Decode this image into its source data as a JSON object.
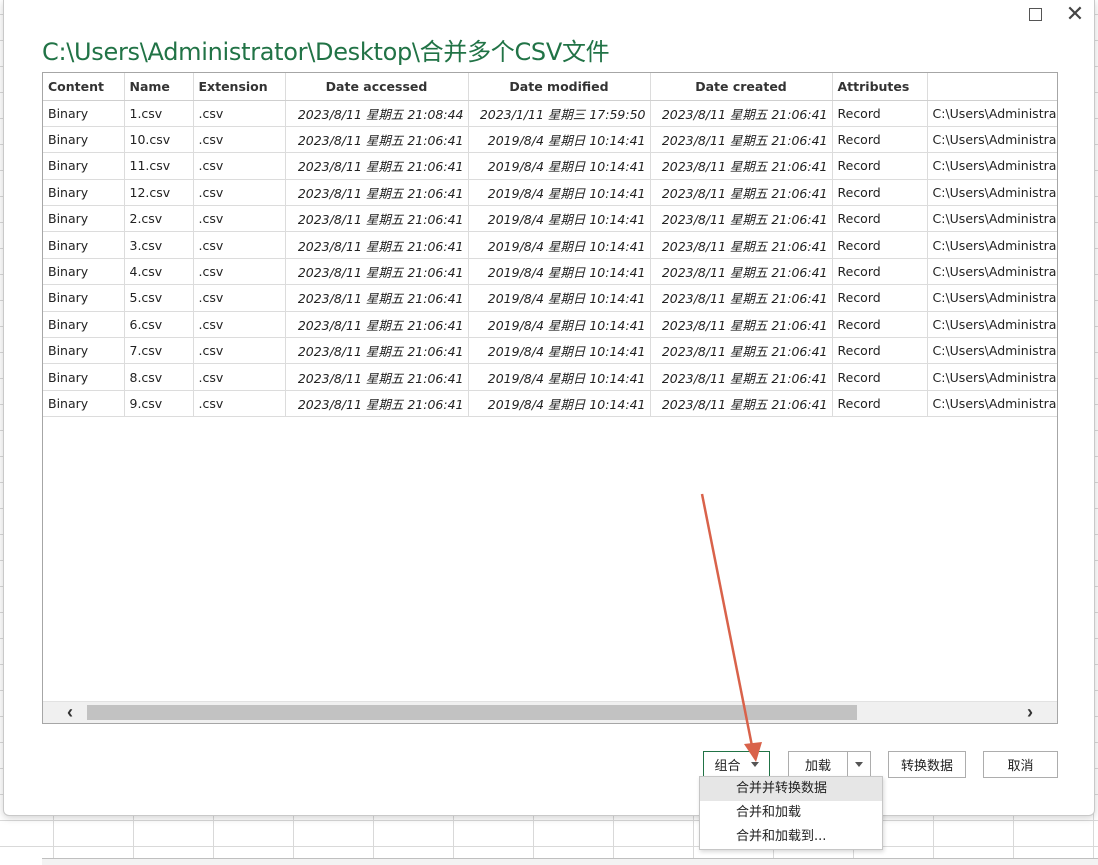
{
  "dialog": {
    "path_title": "C:\\Users\\Administrator\\Desktop\\合并多个CSV文件"
  },
  "table": {
    "columns": [
      "Content",
      "Name",
      "Extension",
      "Date accessed",
      "Date modified",
      "Date created",
      "Attributes",
      "F"
    ],
    "rows": [
      [
        "Binary",
        "1.csv",
        ".csv",
        "2023/8/11 星期五 21:08:44",
        "2023/1/11 星期三 17:59:50",
        "2023/8/11 星期五 21:06:41",
        "Record",
        "C:\\Users\\Administra"
      ],
      [
        "Binary",
        "10.csv",
        ".csv",
        "2023/8/11 星期五 21:06:41",
        "2019/8/4 星期日 10:14:41",
        "2023/8/11 星期五 21:06:41",
        "Record",
        "C:\\Users\\Administra"
      ],
      [
        "Binary",
        "11.csv",
        ".csv",
        "2023/8/11 星期五 21:06:41",
        "2019/8/4 星期日 10:14:41",
        "2023/8/11 星期五 21:06:41",
        "Record",
        "C:\\Users\\Administra"
      ],
      [
        "Binary",
        "12.csv",
        ".csv",
        "2023/8/11 星期五 21:06:41",
        "2019/8/4 星期日 10:14:41",
        "2023/8/11 星期五 21:06:41",
        "Record",
        "C:\\Users\\Administra"
      ],
      [
        "Binary",
        "2.csv",
        ".csv",
        "2023/8/11 星期五 21:06:41",
        "2019/8/4 星期日 10:14:41",
        "2023/8/11 星期五 21:06:41",
        "Record",
        "C:\\Users\\Administra"
      ],
      [
        "Binary",
        "3.csv",
        ".csv",
        "2023/8/11 星期五 21:06:41",
        "2019/8/4 星期日 10:14:41",
        "2023/8/11 星期五 21:06:41",
        "Record",
        "C:\\Users\\Administra"
      ],
      [
        "Binary",
        "4.csv",
        ".csv",
        "2023/8/11 星期五 21:06:41",
        "2019/8/4 星期日 10:14:41",
        "2023/8/11 星期五 21:06:41",
        "Record",
        "C:\\Users\\Administra"
      ],
      [
        "Binary",
        "5.csv",
        ".csv",
        "2023/8/11 星期五 21:06:41",
        "2019/8/4 星期日 10:14:41",
        "2023/8/11 星期五 21:06:41",
        "Record",
        "C:\\Users\\Administra"
      ],
      [
        "Binary",
        "6.csv",
        ".csv",
        "2023/8/11 星期五 21:06:41",
        "2019/8/4 星期日 10:14:41",
        "2023/8/11 星期五 21:06:41",
        "Record",
        "C:\\Users\\Administra"
      ],
      [
        "Binary",
        "7.csv",
        ".csv",
        "2023/8/11 星期五 21:06:41",
        "2019/8/4 星期日 10:14:41",
        "2023/8/11 星期五 21:06:41",
        "Record",
        "C:\\Users\\Administra"
      ],
      [
        "Binary",
        "8.csv",
        ".csv",
        "2023/8/11 星期五 21:06:41",
        "2019/8/4 星期日 10:14:41",
        "2023/8/11 星期五 21:06:41",
        "Record",
        "C:\\Users\\Administra"
      ],
      [
        "Binary",
        "9.csv",
        ".csv",
        "2023/8/11 星期五 21:06:41",
        "2019/8/4 星期日 10:14:41",
        "2023/8/11 星期五 21:06:41",
        "Record",
        "C:\\Users\\Administra"
      ]
    ]
  },
  "scrollbar": {
    "left_arrow": "‹",
    "right_arrow": "›"
  },
  "buttons": {
    "combine": "组合",
    "load": "加载",
    "transform": "转换数据",
    "cancel": "取消"
  },
  "combine_menu": {
    "items": [
      "合并并转换数据",
      "合并和加载",
      "合并和加载到..."
    ],
    "highlighted_index": 0
  },
  "icons": {
    "maximize": "maximize-icon",
    "close": "close-icon",
    "dropdown": "chevron-down-icon",
    "scroll_left": "chevron-left-icon",
    "scroll_right": "chevron-right-icon"
  },
  "colors": {
    "accent_green": "#217346",
    "annotation_arrow": "#d9624a"
  }
}
